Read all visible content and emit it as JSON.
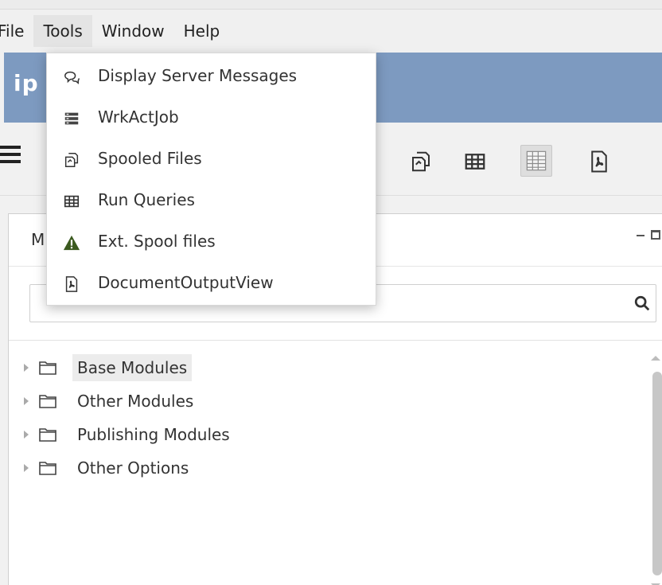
{
  "menubar": {
    "items": [
      {
        "label": "File"
      },
      {
        "label": "Tools"
      },
      {
        "label": "Window"
      },
      {
        "label": "Help"
      }
    ]
  },
  "header": {
    "logo_text": "ip",
    "color": "#7d9ac0"
  },
  "tools_menu": {
    "items": [
      {
        "label": "Display Server Messages",
        "icon": "messages-icon"
      },
      {
        "label": "WrkActJob",
        "icon": "job-list-icon"
      },
      {
        "label": "Spooled Files",
        "icon": "spooled-files-icon"
      },
      {
        "label": "Run Queries",
        "icon": "table-grid-icon"
      },
      {
        "label": "Ext. Spool files",
        "icon": "warning-icon"
      },
      {
        "label": "DocumentOutputView",
        "icon": "pdf-document-icon"
      }
    ]
  },
  "toolbar": {
    "icons": [
      "menu-icon",
      "job-list-icon",
      "spooled-files-icon",
      "table-grid-icon",
      "spreadsheet-icon",
      "pdf-document-icon"
    ]
  },
  "panel": {
    "title": "M",
    "search": {
      "value": "",
      "placeholder": ""
    },
    "tree": [
      {
        "label": "Base Modules"
      },
      {
        "label": "Other Modules"
      },
      {
        "label": "Publishing Modules"
      },
      {
        "label": "Other Options"
      }
    ]
  },
  "colors": {
    "warning": "#3b5a1f",
    "menu_bg": "#ffffff",
    "header_blue": "#7d9ac0"
  }
}
